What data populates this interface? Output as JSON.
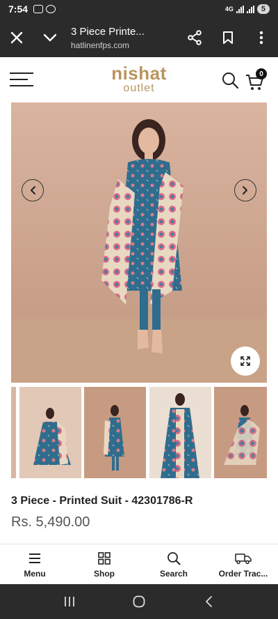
{
  "status_bar": {
    "time": "7:54",
    "network": "4G",
    "battery": "5"
  },
  "browser": {
    "page_title": "3 Piece Printe...",
    "url": "hatlinenfps.com"
  },
  "site": {
    "logo_line1": "nishat",
    "logo_line2": "outlet",
    "cart_count": "0",
    "brand_color": "#b8955e"
  },
  "product": {
    "title": "3 Piece - Printed Suit - 42301786-R",
    "price": "Rs. 5,490.00"
  },
  "bottom_nav": {
    "items": [
      {
        "label": "Menu",
        "icon": "menu-icon"
      },
      {
        "label": "Shop",
        "icon": "grid-icon"
      },
      {
        "label": "Search",
        "icon": "search-icon"
      },
      {
        "label": "Order Trac...",
        "icon": "truck-icon"
      }
    ]
  }
}
